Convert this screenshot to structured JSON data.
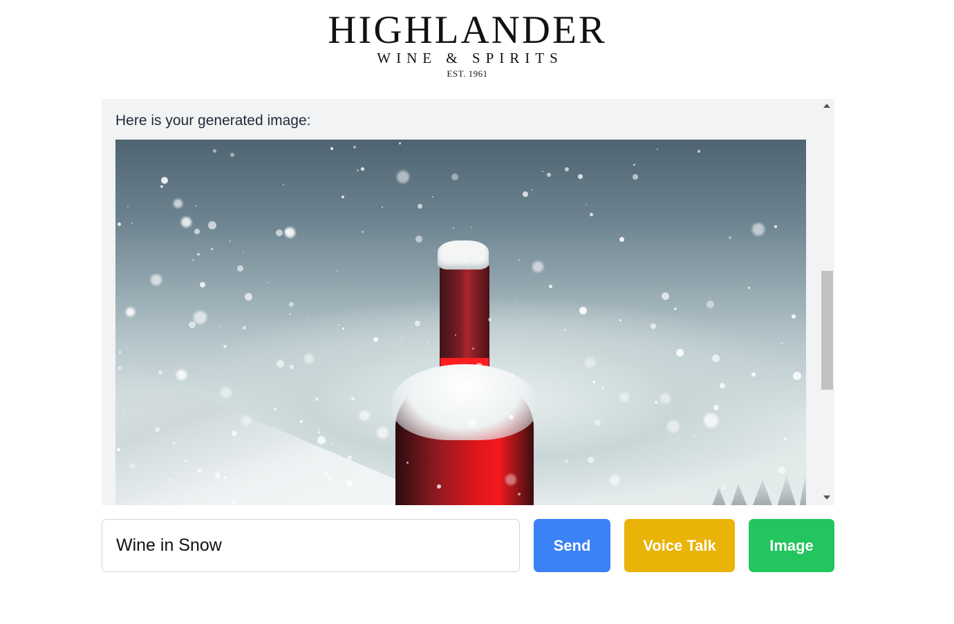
{
  "logo": {
    "brand": "HIGHLANDER",
    "subtitle": "WINE & SPIRITS",
    "established": "EST. 1961"
  },
  "chat": {
    "messages": [
      {
        "text": "Here is your generated image:",
        "image_description": "red wine bottle covered in snow during snowfall"
      }
    ]
  },
  "input": {
    "value": "Wine in Snow",
    "placeholder": ""
  },
  "buttons": {
    "send": "Send",
    "voice_talk": "Voice Talk",
    "image": "Image"
  },
  "colors": {
    "send": "#3b82f6",
    "voice_talk": "#eab308",
    "image": "#22c55e",
    "chat_background": "#f2f3f4"
  }
}
